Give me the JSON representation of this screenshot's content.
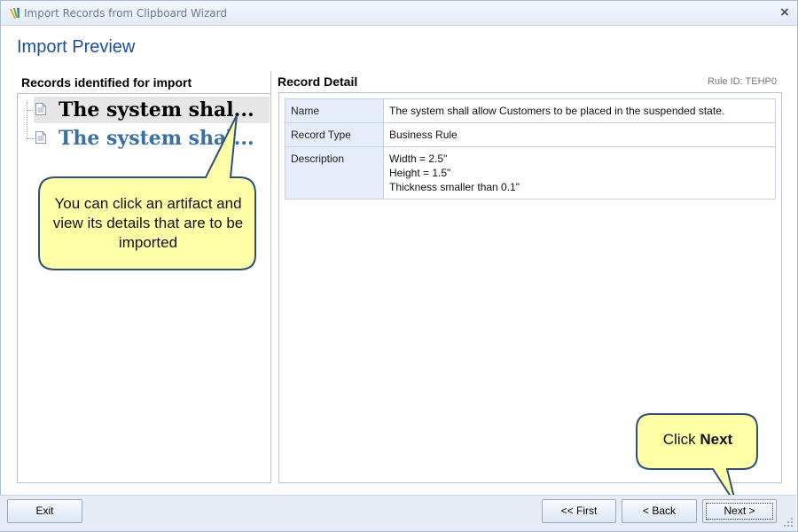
{
  "window": {
    "title": "Import Records from Clipboard Wizard",
    "close_glyph": "×"
  },
  "page": {
    "title": "Import Preview"
  },
  "left": {
    "header": "Records identified for import",
    "items": [
      {
        "label": "The system shal...",
        "icon": "document-icon",
        "selected": true
      },
      {
        "label": "The system shal...",
        "icon": "document-icon",
        "selected": false
      }
    ]
  },
  "right": {
    "header": "Record Detail",
    "rule_id": "Rule ID: TEHP0",
    "rows": [
      {
        "key": "Name",
        "value": [
          "The system shall allow Customers to be placed in the suspended state."
        ]
      },
      {
        "key": "Record Type",
        "value": [
          "Business Rule"
        ]
      },
      {
        "key": "Description",
        "value": [
          "Width = 2.5\"",
          "Height = 1.5\"",
          "Thickness smaller than 0.1\""
        ]
      }
    ]
  },
  "callouts": {
    "left": "You can click an artifact and view its details that are to be imported",
    "right_prefix": "Click ",
    "right_bold": "Next"
  },
  "footer": {
    "exit": "Exit",
    "first": "<< First",
    "back": "< Back",
    "next": "Next >"
  },
  "colors": {
    "accent": "#1e4e9a",
    "callout_fill": "#ffffa8",
    "callout_stroke": "#2f4e78"
  }
}
